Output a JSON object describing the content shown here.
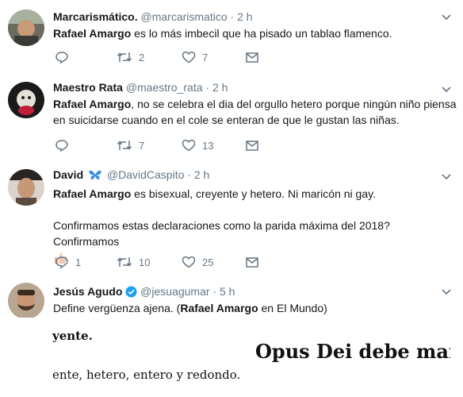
{
  "tweets": [
    {
      "name": "Marcarismático.",
      "handle": "@marcarismatico",
      "time": "· 2 h",
      "text_bold": "Rafael Amargo",
      "text_rest": " es lo más imbecil que ha pisado un tablao flamenco.",
      "reply_count": "",
      "retweet_count": "2",
      "like_count": "7"
    },
    {
      "name": "Maestro Rata",
      "handle": "@maestro_rata",
      "time": "· 2 h",
      "text_bold": "Rafael Amargo",
      "text_rest": ", no se celebra el dia del orgullo hetero porque ningùn niño piensa en suicidarse cuando en el cole se enteran de que le gustan las niñas.",
      "reply_count": "",
      "retweet_count": "7",
      "like_count": "13"
    },
    {
      "name": "David",
      "handle": "@DavidCaspito",
      "time": "· 2 h",
      "text_bold": "Rafael Amargo",
      "text_rest": " es bisexual, creyente y hetero. Ni maricón ni gay.",
      "text_line2": "Confirmamos estas declaraciones como la parida máxima del 2018? Confirmamos",
      "reply_count": "1",
      "retweet_count": "10",
      "like_count": "25"
    },
    {
      "name": "Jesús Agudo",
      "handle": "@jesuagumar",
      "time": "· 5 h",
      "text_pre": "Define vergüenza ajena. (",
      "text_bold": "Rafael Amargo",
      "text_post": " en El Mundo)"
    }
  ],
  "article": {
    "line1": "yente.",
    "headline": "Opus Dei debe mar",
    "line2": "ente, hetero, entero y redondo."
  },
  "icons": {
    "reply": "reply-icon",
    "retweet": "retweet-icon",
    "like": "heart-icon",
    "dm": "envelope-icon",
    "caret": "chevron-down-icon",
    "butterfly": "butterfly-emoji-icon",
    "thumbs": "thumbs-up-emoji-icon",
    "verified": "verified-badge-icon"
  },
  "colors": {
    "text": "#14171a",
    "secondary": "#657786",
    "verified": "#1da1f2",
    "butterfly": "#3b8fe0"
  }
}
